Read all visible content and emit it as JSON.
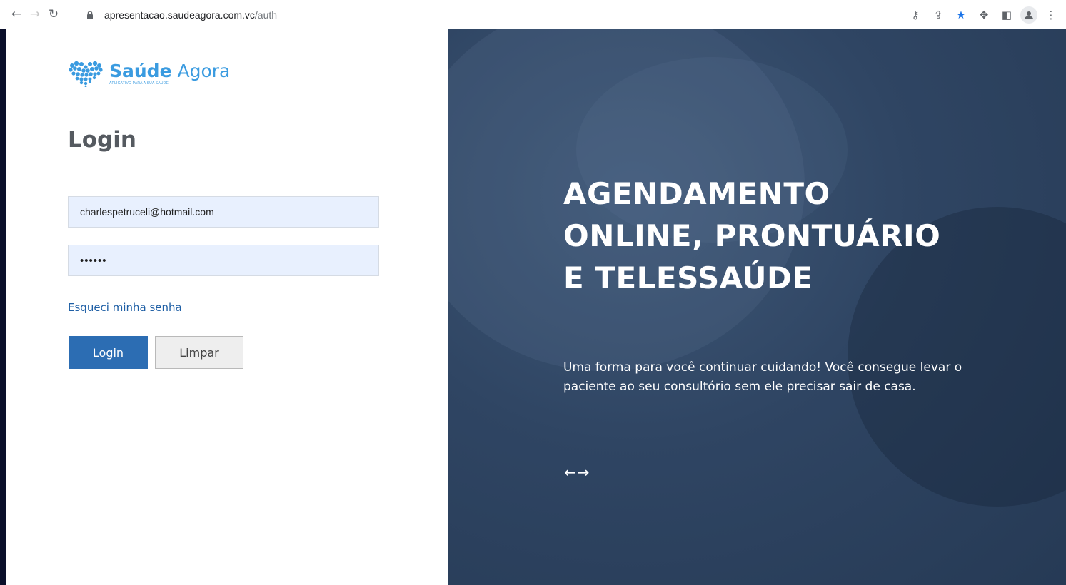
{
  "browser": {
    "url_host": "apresentacao.saudeagora.com.vc",
    "url_path": "/auth",
    "icons": [
      "back-icon",
      "forward-icon",
      "reload-icon",
      "lock-icon",
      "key-icon",
      "share-icon",
      "star-icon",
      "extensions-icon",
      "sidepanel-icon",
      "profile-icon",
      "menu-icon"
    ],
    "accent_color": "#1a73e8"
  },
  "logo": {
    "name_bold": "Saúde",
    "name_regular": " Agora",
    "tagline": "APLICATIVO PARA A SUA SAÚDE",
    "color": "#3a9be0"
  },
  "login": {
    "title": "Login",
    "email_value": "charlespetruceli@hotmail.com",
    "password_value": "••••••",
    "forgot_link": "Esqueci minha senha",
    "login_button": "Login",
    "clear_button": "Limpar",
    "primary_color": "#2c6db3"
  },
  "hero": {
    "title_lines": [
      "AGENDAMENTO",
      "ONLINE, PRONTUÁRIO",
      "E TELESSAÚDE"
    ],
    "text": "Uma forma para você continuar cuidando! Você consegue levar o paciente ao seu consultório sem ele precisar sair de casa.",
    "prev_arrow": "←",
    "next_arrow": "→",
    "background_color": "#2f4563"
  }
}
